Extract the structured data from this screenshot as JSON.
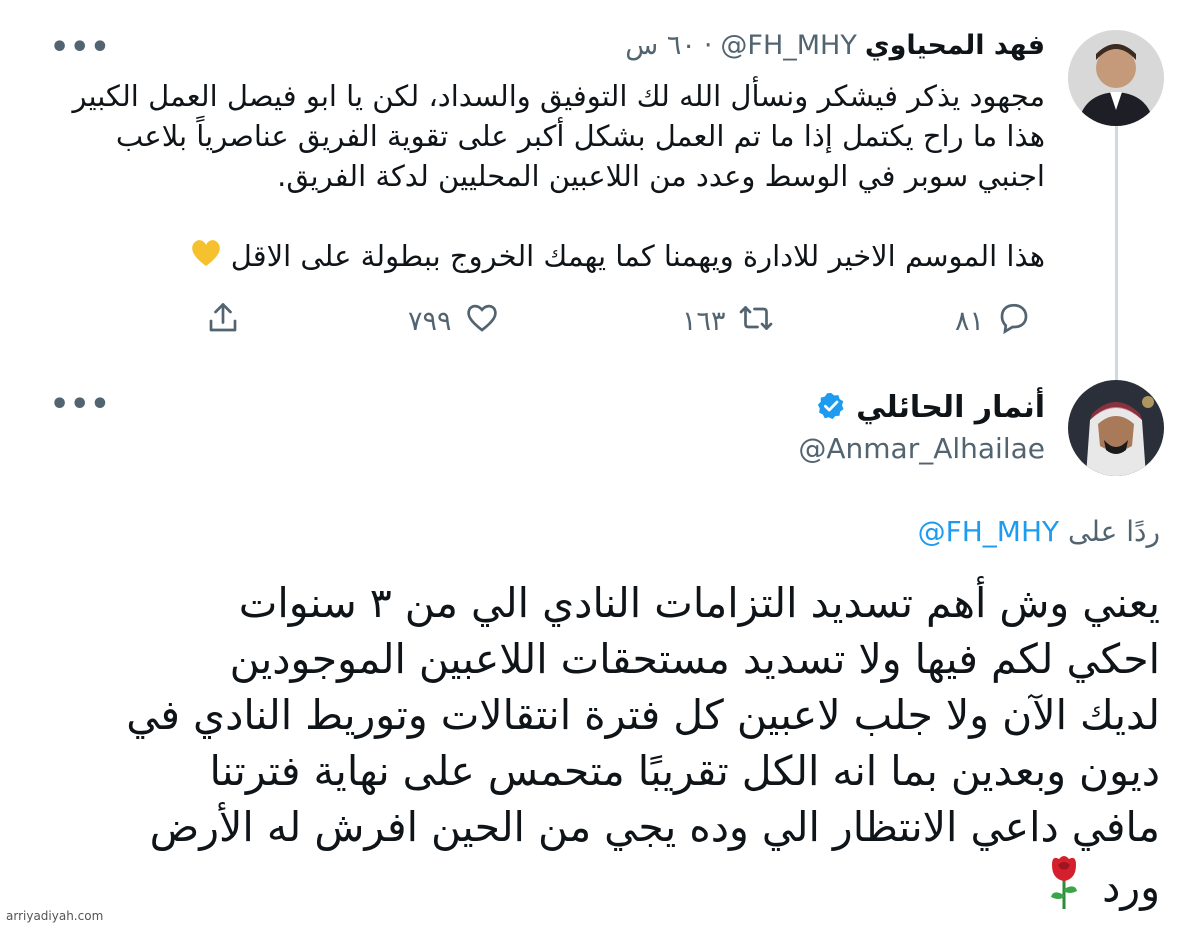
{
  "tweet1": {
    "name": "فهد المحياوي",
    "handle": "@FH_MHY",
    "time": "٦٠ س",
    "body_lines": [
      "مجهود يذكر فيشكر ونسأل الله لك التوفيق والسداد، لكن يا ابو فيصل العمل الكبير",
      "هذا ما راح يكتمل إذا ما تم العمل بشكل أكبر على تقوية الفريق عناصرياً بلاعب",
      "اجنبي سوبر في الوسط وعدد من اللاعبين المحليين لدكة الفريق."
    ],
    "body_line2": "هذا الموسم الاخير للادارة ويهمنا كما يهمك الخروج ببطولة على الاقل",
    "reply_count": "٨١",
    "retweet_count": "١٦٣",
    "like_count": "٧٩٩",
    "more_label": "•••"
  },
  "tweet2": {
    "name": "أنمار الحائلي",
    "handle": "@Anmar_Alhailae",
    "reply_to_label": "ردًا على",
    "reply_to_handle": "@FH_MHY",
    "body_lines": [
      "يعني وش أهم تسديد التزامات النادي الي من ٣ سنوات",
      "احكي لكم فيها ولا تسديد مستحقات اللاعبين الموجودين",
      "لديك الآن ولا جلب لاعبين كل فترة انتقالات وتوريط النادي في",
      "ديون وبعدين بما انه الكل تقريبًا متحمس على نهاية فترتنا",
      "مافي داعي الانتظار الي وده يجي من الحين افرش له الأرض",
      "ورد"
    ],
    "more_label": "•••"
  },
  "watermark": "arriyadiyah.com",
  "colors": {
    "accent": "#1d9bf0",
    "muted": "#536471",
    "text": "#0f1419"
  }
}
